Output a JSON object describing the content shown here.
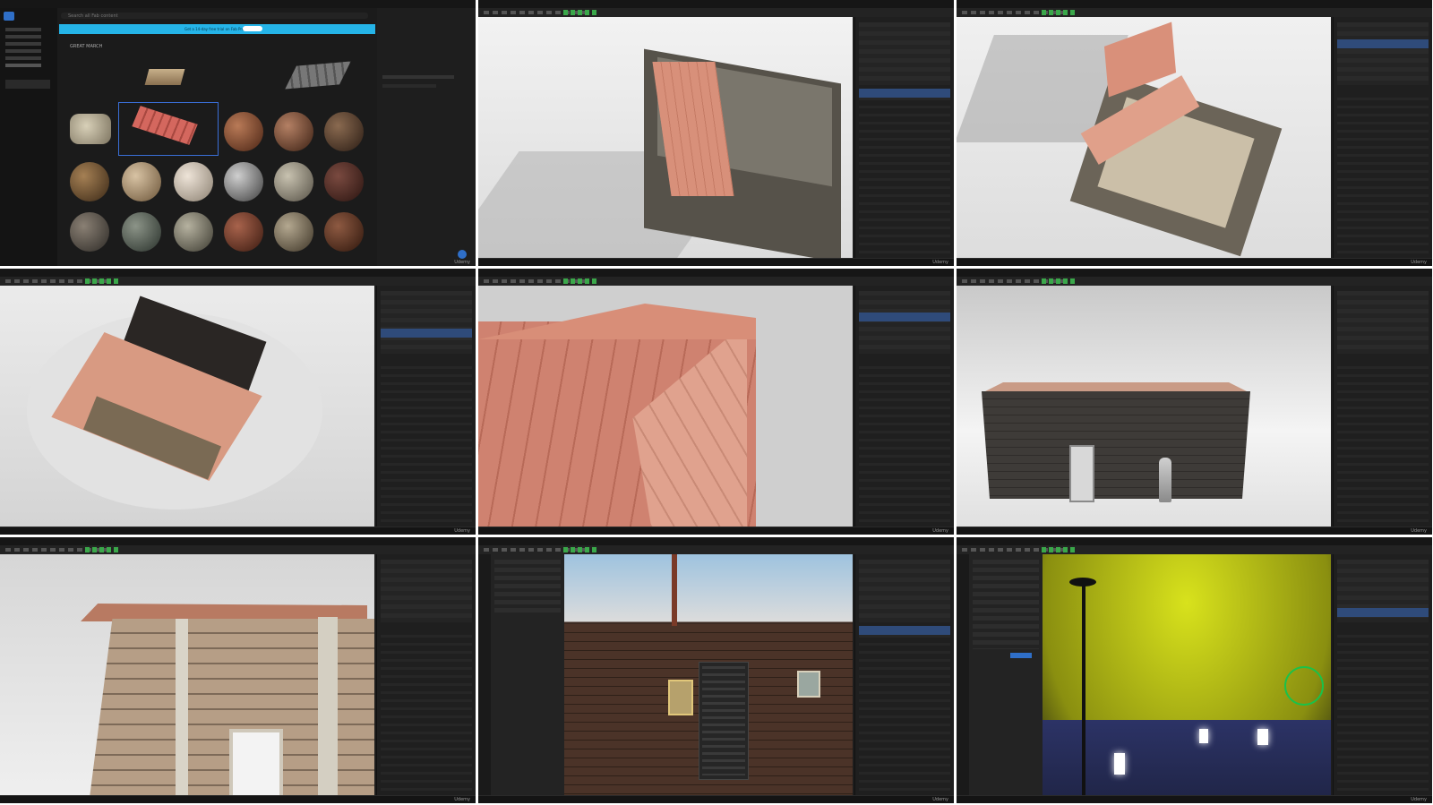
{
  "watermark": "Udemy",
  "fab": {
    "search_placeholder": "Search all Fab content",
    "banner_text": "Get a 14-day free trial on Fab Pro",
    "banner_button": "Start Trial",
    "section_title": "GREAT MARCH",
    "sidebar": [
      "Home",
      "Characters",
      "Environments",
      "3D Models",
      "Materials",
      "Textures",
      "Games",
      "Blueprints"
    ]
  },
  "panels": {
    "outliner_title": "Outliner",
    "details_title": "Details",
    "detail_tab": "Actor"
  },
  "viewport": {
    "view_mode": "Lit",
    "camera_speed": "4",
    "perspective": "Perspective"
  },
  "colors": {
    "accent": "#2f6fc8",
    "banner": "#25b4e8",
    "roof": "#d9846c",
    "wall": "#4a4740",
    "sky_yellow": "#c6d31a",
    "play_green": "#3aa84a"
  }
}
